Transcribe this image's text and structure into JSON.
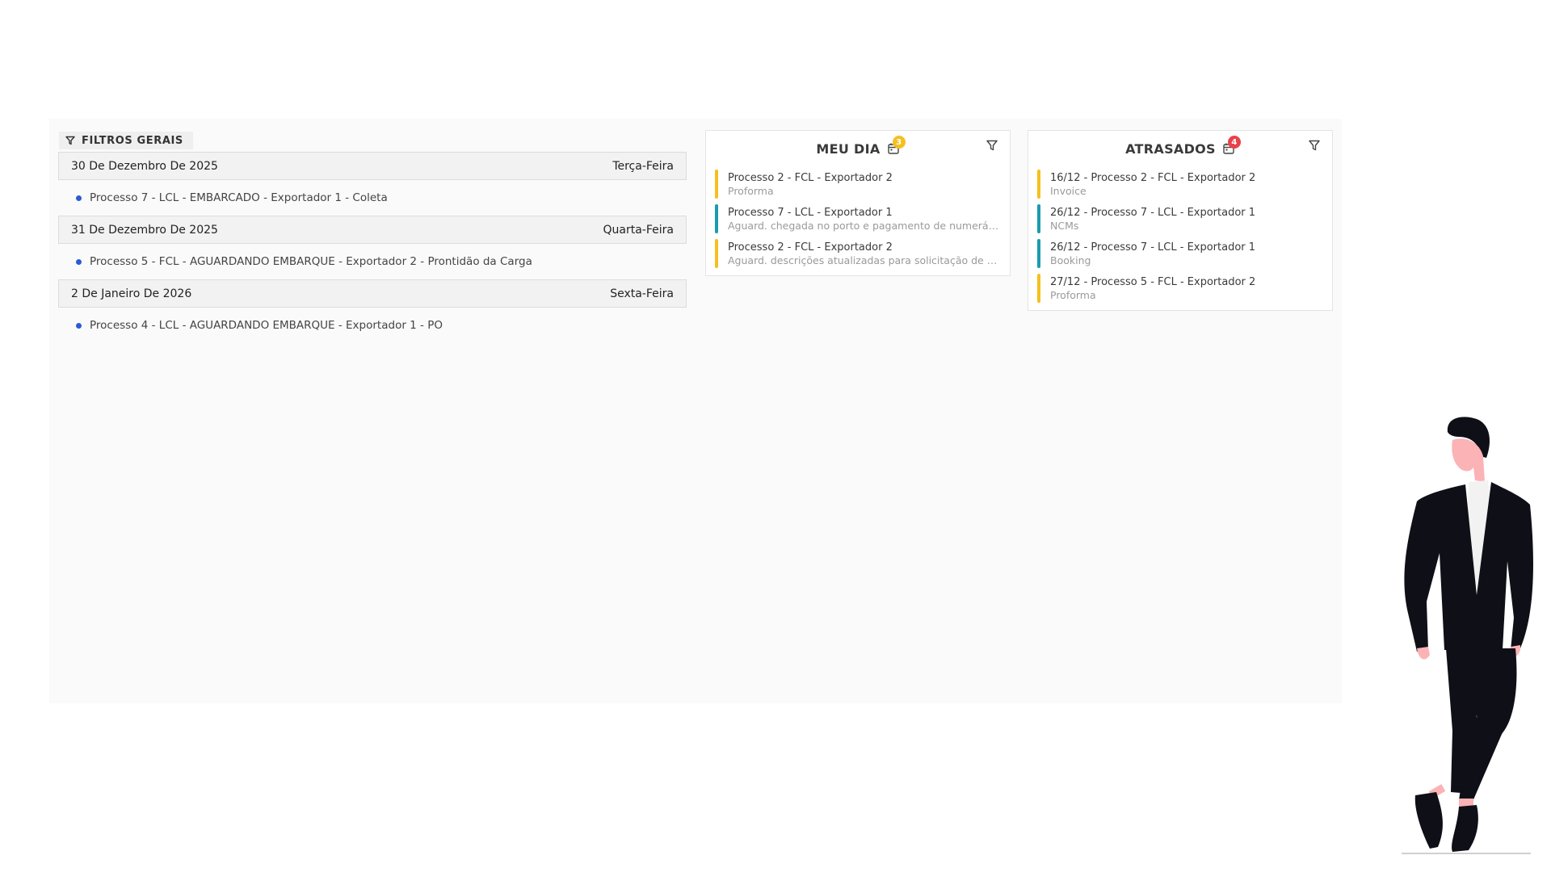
{
  "filters": {
    "label": "FILTROS GERAIS",
    "icon": "filter-icon"
  },
  "agenda": [
    {
      "date": "30 De Dezembro De 2025",
      "weekday": "Terça-Feira",
      "events": [
        {
          "text": "Processo 7 - LCL - EMBARCADO - Exportador 1 - Coleta"
        }
      ]
    },
    {
      "date": "31 De Dezembro De 2025",
      "weekday": "Quarta-Feira",
      "events": [
        {
          "text": "Processo 5 - FCL - AGUARDANDO EMBARQUE - Exportador 2 - Prontidão da Carga"
        }
      ]
    },
    {
      "date": "2 De Janeiro De 2026",
      "weekday": "Sexta-Feira",
      "events": [
        {
          "text": "Processo 4 - LCL - AGUARDANDO EMBARQUE - Exportador 1 - PO"
        }
      ]
    }
  ],
  "meu_dia": {
    "title": "MEU DIA",
    "badge": "3",
    "tasks": [
      {
        "title": "Processo 2 - FCL - Exportador 2",
        "subtitle": "Proforma",
        "color": "#f5c01e"
      },
      {
        "title": "Processo 7 - LCL - Exportador 1",
        "subtitle": "Aguard. chegada no porto e pagamento de numerário",
        "color": "#1a9cad"
      },
      {
        "title": "Processo 2 - FCL - Exportador 2",
        "subtitle": "Aguard. descrições atualizadas para solicitação de nu...",
        "color": "#f5c01e"
      }
    ]
  },
  "atrasados": {
    "title": "ATRASADOS",
    "badge": "4",
    "tasks": [
      {
        "title": "16/12 - Processo 2 - FCL - Exportador 2",
        "subtitle": "Invoice",
        "color": "#f5c01e"
      },
      {
        "title": "26/12 - Processo 7 - LCL - Exportador 1",
        "subtitle": "NCMs",
        "color": "#1a9cad"
      },
      {
        "title": "26/12 - Processo 7 - LCL - Exportador 1",
        "subtitle": "Booking",
        "color": "#1a9cad"
      },
      {
        "title": "27/12 - Processo 5 - FCL - Exportador 2",
        "subtitle": "Proforma",
        "color": "#f5c01e"
      }
    ]
  },
  "colors": {
    "event_dot": "#2a5bd7",
    "panel_bg": "#fafafa",
    "suit": "#0f0f17",
    "skin": "#fbb3b6"
  }
}
